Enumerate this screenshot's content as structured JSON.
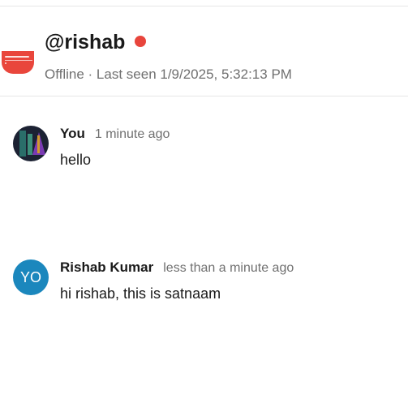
{
  "header": {
    "title": "@rishab",
    "subtitle": "Offline · Last seen 1/9/2025, 5:32:13 PM",
    "status_color": "#e8453c",
    "avatar_icon": "channel-logo-icon"
  },
  "messages": [
    {
      "author": "You",
      "time": "1 minute ago",
      "text": "hello",
      "avatar_type": "image"
    },
    {
      "author": "Rishab Kumar",
      "time": "less than a minute ago",
      "text": "hi rishab, this is satnaam",
      "avatar_type": "initials",
      "initials": "YO",
      "avatar_color": "#1b87bd"
    }
  ]
}
